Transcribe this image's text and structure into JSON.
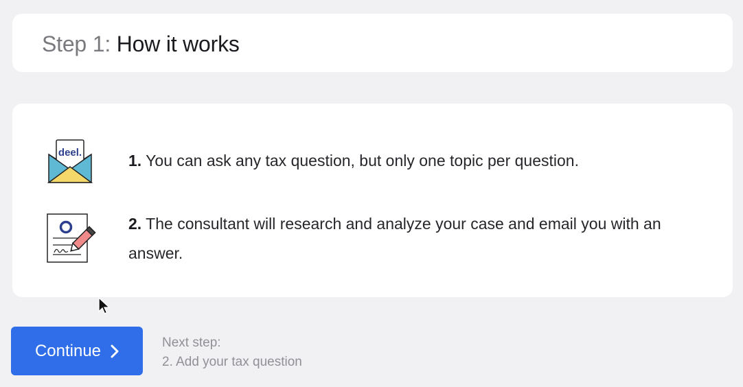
{
  "header": {
    "step_prefix": "Step 1:",
    "title": "How it works"
  },
  "steps": [
    {
      "number": "1.",
      "text": "You can ask any tax question, but only one topic per question.",
      "icon": "envelope-icon",
      "icon_label": "deel."
    },
    {
      "number": "2.",
      "text": "The consultant will research and analyze your case and email you with an answer.",
      "icon": "document-pencil-icon"
    }
  ],
  "footer": {
    "continue_label": "Continue",
    "next_step_label": "Next step:",
    "next_step_value": "2. Add your tax question"
  },
  "colors": {
    "primary": "#2f6ee8",
    "background": "#f1f1f3",
    "card": "#ffffff"
  }
}
